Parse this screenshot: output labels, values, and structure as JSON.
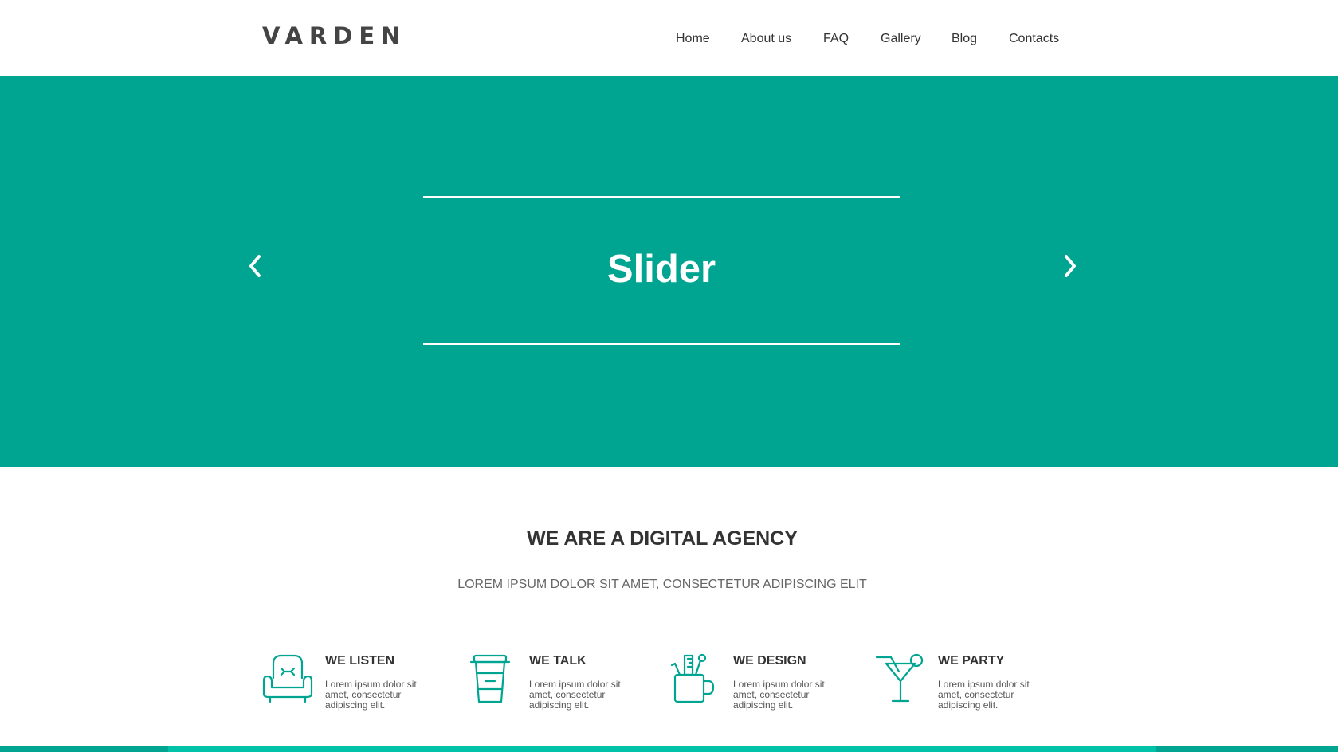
{
  "header": {
    "logo": "VARDEN",
    "nav": [
      "Home",
      "About us",
      "FAQ",
      "Gallery",
      "Blog",
      "Contacts"
    ]
  },
  "hero": {
    "title": "Slider",
    "prev_icon": "chevron-left-icon",
    "next_icon": "chevron-right-icon"
  },
  "intro": {
    "title": "WE ARE A DIGITAL AGENCY",
    "subtitle": "LOREM IPSUM DOLOR SIT AMET, CONSECTETUR ADIPISCING ELIT"
  },
  "features": [
    {
      "icon": "armchair-icon",
      "title": "WE LISTEN",
      "text": "Lorem ipsum dolor sit amet, consectetur adipiscing elit."
    },
    {
      "icon": "coffee-cup-icon",
      "title": "WE TALK",
      "text": "Lorem ipsum dolor sit amet, consectetur adipiscing elit."
    },
    {
      "icon": "pencil-cup-icon",
      "title": "WE DESIGN",
      "text": "Lorem ipsum dolor sit amet, consectetur adipiscing elit."
    },
    {
      "icon": "cocktail-icon",
      "title": "WE PARTY",
      "text": "Lorem ipsum dolor sit amet, consectetur adipiscing elit."
    }
  ],
  "colors": {
    "accent": "#00a591",
    "accent_light": "#00c2a9",
    "text": "#333333"
  }
}
